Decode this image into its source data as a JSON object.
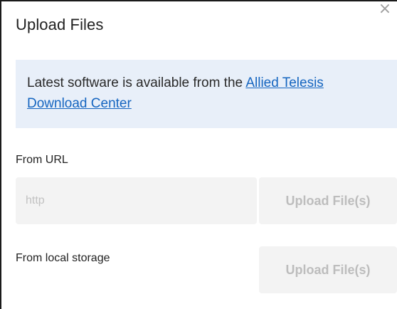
{
  "dialog": {
    "title": "Upload Files",
    "close_icon": "close-icon"
  },
  "info": {
    "text": "Latest software is available from the ",
    "link_text": "Allied Telesis Download Center"
  },
  "from_url": {
    "label": "From URL",
    "input_placeholder": "http",
    "input_value": "",
    "button_label": "Upload File(s)"
  },
  "from_local": {
    "label": "From local storage",
    "button_label": "Upload File(s)"
  },
  "colors": {
    "info_background": "#e8eff9",
    "link": "#1565c0",
    "disabled_text": "#bdbdbd",
    "disabled_background": "#f3f3f3"
  }
}
